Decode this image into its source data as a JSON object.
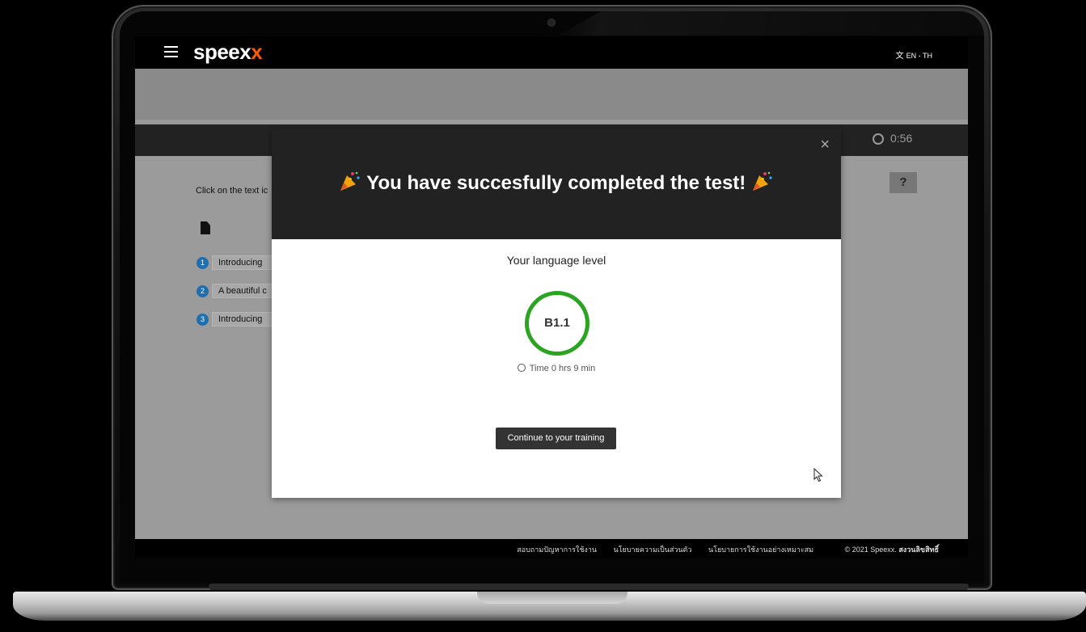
{
  "header": {
    "menu_icon": "hamburger-icon",
    "logo_text": "speex",
    "logo_accent": "x",
    "language": "EN - TH",
    "language_icon": "translate-icon"
  },
  "exercise": {
    "timer": "0:56",
    "timer_icon": "clock-icon",
    "instruction": "Click on the text ic",
    "help_label": "?",
    "items": [
      {
        "number": "1",
        "label": "Introducing"
      },
      {
        "number": "2",
        "label": "A beautiful c"
      },
      {
        "number": "3",
        "label": "Introducing"
      }
    ]
  },
  "modal": {
    "title": "You have succesfully completed the test!",
    "close_label": "×",
    "level_label": "Your language level",
    "level": "B1.1",
    "time_text": "Time 0 hrs 9 min",
    "cta_label": "Continue to your training"
  },
  "footer": {
    "links": [
      "สอบถามปัญหาการใช้งาน",
      "นโยบายความเป็นส่วนตัว",
      "นโยบายการใช้งานอย่างเหมาะสม"
    ],
    "copyright": "© 2021 Speexx.",
    "rights": "สงวนลิขสิทธิ์"
  },
  "colors": {
    "brand_accent": "#ff5a00",
    "level_ring": "#2aa421",
    "item_badge": "#1e6fb0"
  }
}
